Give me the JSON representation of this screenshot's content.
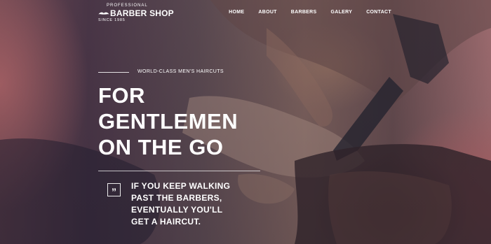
{
  "logo": {
    "professional": "PROFESSIONAL",
    "name": "BARBER SHOP",
    "since": "SINCE 1985"
  },
  "nav": {
    "items": [
      "HOME",
      "ABOUT",
      "BARBERS",
      "GALERY",
      "CONTACT"
    ]
  },
  "hero": {
    "tagline": "WORLD-CLASS MEN'S HAIRCUTS",
    "headline": [
      "FOR",
      "GENTLEMEN",
      "ON THE GO"
    ],
    "quote_icon": "”",
    "quote": [
      "IF YOU KEEP WALKING",
      "PAST THE BARBERS,",
      "EVENTUALLY YOU'LL",
      "GET A HAIRCUT."
    ]
  }
}
